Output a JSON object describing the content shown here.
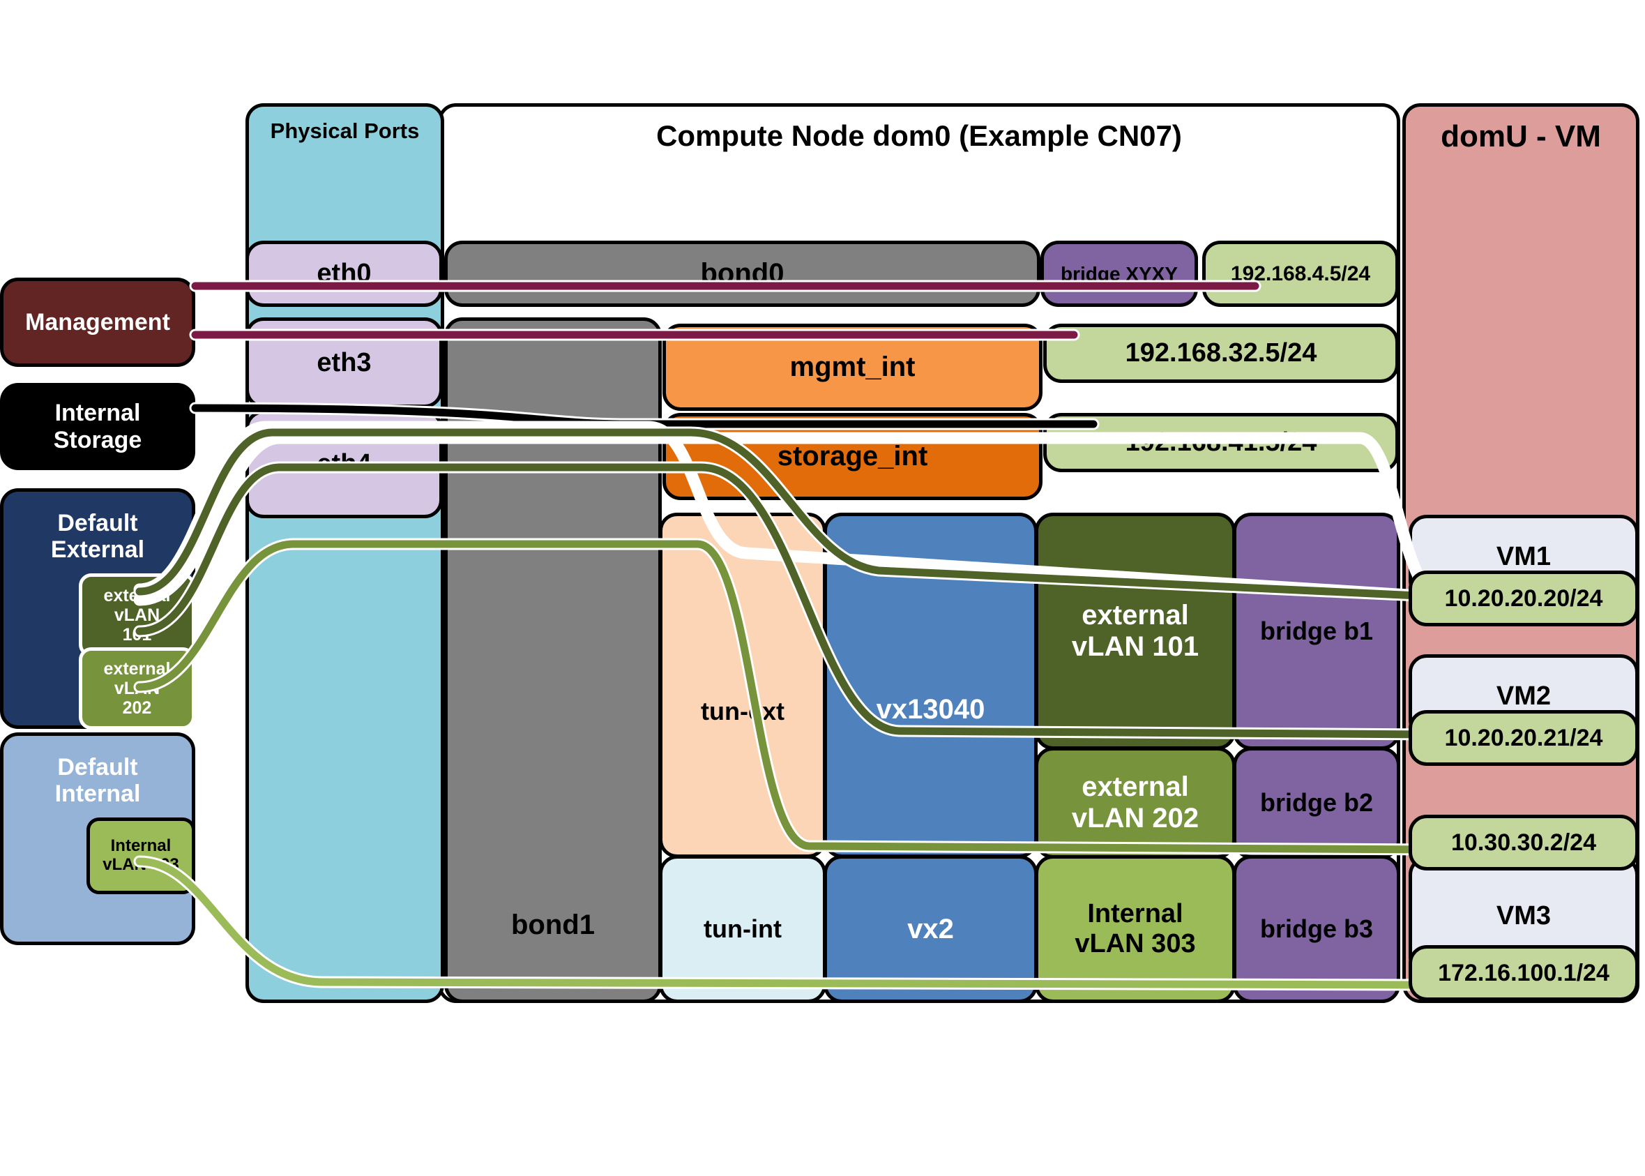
{
  "diagram": {
    "title_dom0": "Compute Node dom0 (Example CN07)",
    "title_domu": "domU - VM",
    "physical_ports_label": "Physical Ports"
  },
  "sources": [
    {
      "id": "management",
      "label": "Management",
      "color": "#632523"
    },
    {
      "id": "internal-storage",
      "label": "Internal\nStorage",
      "color": "#000000"
    },
    {
      "id": "default-external",
      "label": "Default\nExternal",
      "color": "#1f3864"
    },
    {
      "id": "default-internal",
      "label": "Default\nInternal",
      "color": "#95b3d7"
    }
  ],
  "source_vlans": [
    {
      "id": "external-vlan-101",
      "label": "external\nvLAN\n101",
      "color": "#4f6228"
    },
    {
      "id": "external-vlan-202",
      "label": "external\nvLAN\n202",
      "color": "#77933c"
    },
    {
      "id": "internal-vlan-303",
      "label": "Internal\nvLAN 303",
      "color": "#9bbb59"
    }
  ],
  "physical_ports": [
    {
      "id": "eth0",
      "label": "eth0"
    },
    {
      "id": "eth3",
      "label": "eth3"
    },
    {
      "id": "eth4",
      "label": "eth4"
    }
  ],
  "bonds": [
    {
      "id": "bond0",
      "label": "bond0"
    },
    {
      "id": "bond1",
      "label": "bond1"
    }
  ],
  "dom0_interfaces": [
    {
      "id": "bridge-xyxy",
      "label": "bridge XYXY"
    },
    {
      "id": "mgmt-int",
      "label": "mgmt_int"
    },
    {
      "id": "storage-int",
      "label": "storage_int"
    },
    {
      "id": "tun-ext",
      "label": "tun-ext"
    },
    {
      "id": "tun-int",
      "label": "tun-int"
    },
    {
      "id": "vx13040",
      "label": "vx13040"
    },
    {
      "id": "vx2",
      "label": "vx2"
    }
  ],
  "dom0_vlans": [
    {
      "id": "external-vlan-101",
      "label": "external\nvLAN 101"
    },
    {
      "id": "external-vlan-202",
      "label": "external\nvLAN 202"
    },
    {
      "id": "internal-vlan-303",
      "label": "Internal\nvLAN 303"
    }
  ],
  "bridges": [
    {
      "id": "bridge-b1",
      "label": "bridge b1"
    },
    {
      "id": "bridge-b2",
      "label": "bridge b2"
    },
    {
      "id": "bridge-b3",
      "label": "bridge b3"
    }
  ],
  "dom0_addresses": [
    {
      "id": "addr-mgmt-bridge",
      "label": "192.168.4.5/24"
    },
    {
      "id": "addr-mgmt-int",
      "label": "192.168.32.5/24"
    },
    {
      "id": "addr-storage-int",
      "label": "192.168.41.5/24"
    }
  ],
  "vms": [
    {
      "id": "vm1",
      "label": "VM1",
      "address": "10.20.20.20/24"
    },
    {
      "id": "vm2",
      "label": "VM2",
      "address": "10.20.20.21/24"
    },
    {
      "id": "vm3",
      "label": "VM3",
      "address_top": "10.30.30.2/24",
      "address_bottom": "172.16.100.1/24"
    }
  ],
  "wire_colors": {
    "management": "#7b1b45",
    "internal_storage": "#000000",
    "external_101": "#4f6228",
    "external_202": "#77933c",
    "internal_303": "#9bbb59"
  }
}
